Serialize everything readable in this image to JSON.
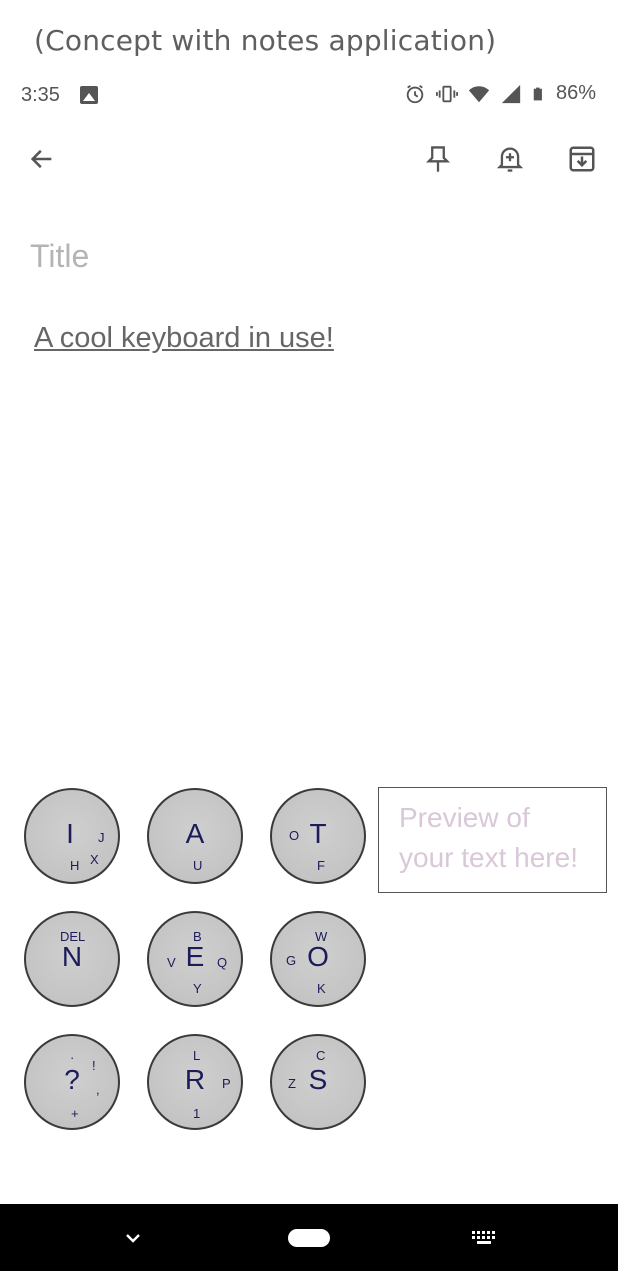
{
  "caption": "(Concept with notes application)",
  "status_bar": {
    "time": "3:35",
    "battery": "86%",
    "icons": [
      "image-icon",
      "alarm-icon",
      "vibrate-icon",
      "wifi-icon",
      "signal-icon",
      "battery-icon"
    ]
  },
  "toolbar": {
    "icons": [
      "back-arrow-icon",
      "pin-icon",
      "reminder-bell-icon",
      "archive-icon"
    ]
  },
  "note": {
    "title_placeholder": "Title",
    "body": "A cool keyboard in use!"
  },
  "keyboard": {
    "keys": [
      {
        "main": "I",
        "subs": [
          "J",
          "H",
          "X"
        ]
      },
      {
        "main": "A",
        "subs": [
          "U"
        ]
      },
      {
        "main": "T",
        "subs": [
          "O",
          "F"
        ]
      },
      {
        "main": "N",
        "subs": [
          "DEL"
        ]
      },
      {
        "main": "E",
        "subs": [
          "B",
          "V",
          "Q",
          "Y"
        ]
      },
      {
        "main": "O",
        "subs": [
          "W",
          "G",
          "K"
        ]
      },
      {
        "main": "?",
        "subs": [
          "·",
          "!",
          ",",
          "+"
        ]
      },
      {
        "main": "R",
        "subs": [
          "L",
          "P",
          "1"
        ]
      },
      {
        "main": "S",
        "subs": [
          "C",
          "Z"
        ]
      }
    ],
    "preview_text": "Preview of your text here!"
  },
  "nav_bar": {
    "icons": [
      "hide-keyboard-chevron-icon",
      "home-pill-icon",
      "keyboard-switch-icon"
    ]
  },
  "colors": {
    "key_fill": "#c8c8c8",
    "key_text": "#1c1c5a",
    "preview_text": "#d8c8d8",
    "nav_bg": "#000000"
  }
}
